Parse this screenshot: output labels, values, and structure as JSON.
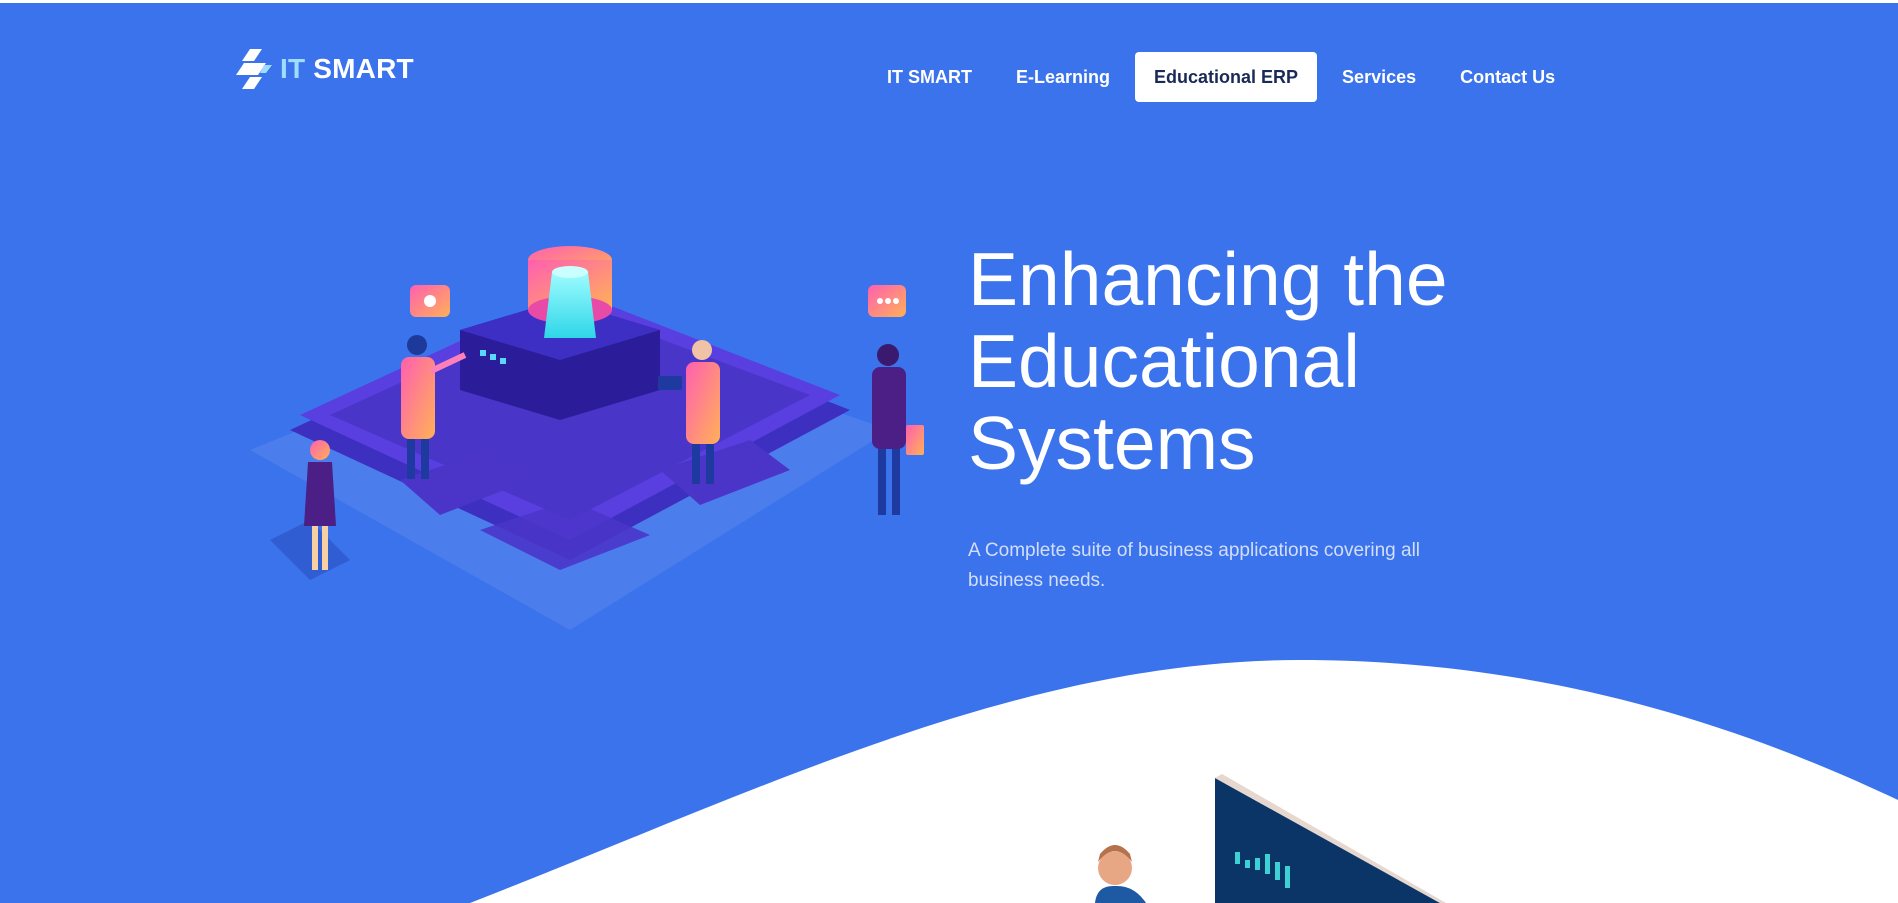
{
  "header": {
    "logo": {
      "prefix": "IT",
      "suffix": " SMART"
    },
    "nav": [
      {
        "label": "IT SMART",
        "active": false
      },
      {
        "label": "E-Learning",
        "active": false
      },
      {
        "label": "Educational ERP",
        "active": true
      },
      {
        "label": "Services",
        "active": false
      },
      {
        "label": "Contact Us",
        "active": false
      }
    ]
  },
  "hero": {
    "title_lines": [
      "Enhancing the",
      "Educational",
      "Systems"
    ],
    "subtitle": "A Complete suite of business applications covering all business needs.",
    "illustration_icon": "isometric-server-team-illustration"
  },
  "colors": {
    "background": "#3b73ec",
    "nav_active_bg": "#ffffff",
    "nav_active_text": "#1a2a57",
    "logo_accent": "#9fdcff",
    "subtitle_text": "#d2defb"
  }
}
